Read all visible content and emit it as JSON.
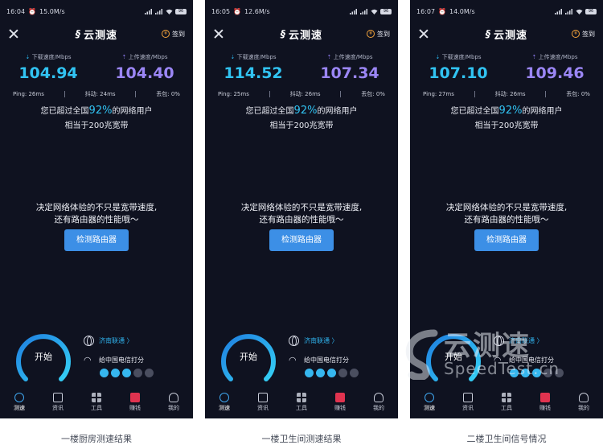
{
  "phones": [
    {
      "status": {
        "time": "16:04",
        "net_speed": "15.0M/s",
        "battery": "96"
      },
      "download": "104.94",
      "upload": "104.40",
      "ping": "Ping: 26ms",
      "jitter": "抖动: 24ms",
      "loss": "丢包: 0%",
      "caption": "一楼厨房测速结果"
    },
    {
      "status": {
        "time": "16:05",
        "net_speed": "12.6M/s",
        "battery": "96"
      },
      "download": "114.52",
      "upload": "107.34",
      "ping": "Ping: 25ms",
      "jitter": "抖动: 26ms",
      "loss": "丢包: 0%",
      "caption": "一楼卫生间测速结果"
    },
    {
      "status": {
        "time": "16:07",
        "net_speed": "14.0M/s",
        "battery": "96"
      },
      "download": "107.10",
      "upload": "109.46",
      "ping": "Ping: 27ms",
      "jitter": "抖动: 26ms",
      "loss": "丢包: 0%",
      "caption": "二楼卫生间信号情况"
    }
  ],
  "common": {
    "logo": "云测速",
    "sign_in": "签到",
    "download_label": "下载速度/Mbps",
    "upload_label": "上传速度/Mbps",
    "beat_prefix": "您已超过全国",
    "beat_pct": "92%",
    "beat_suffix": "的网络用户",
    "equivalent": "相当于200兆宽带",
    "promo_line1": "决定网络体验的不只是宽带速度,",
    "promo_line2": "还有路由器的性能哦～",
    "router_button": "检测路由器",
    "start": "开始",
    "isp": "济南联通 〉",
    "rate": "给中国电信打分",
    "faces_on": 3,
    "tabs": [
      "测速",
      "资讯",
      "工具",
      "赚钱",
      "我的"
    ]
  },
  "watermark": {
    "title": "云测速",
    "subtitle": "SpeedTest.cn"
  },
  "colors": {
    "bg": "#0f1220",
    "download": "#31c3f2",
    "upload": "#9b86f5",
    "button": "#3c8fe6"
  }
}
